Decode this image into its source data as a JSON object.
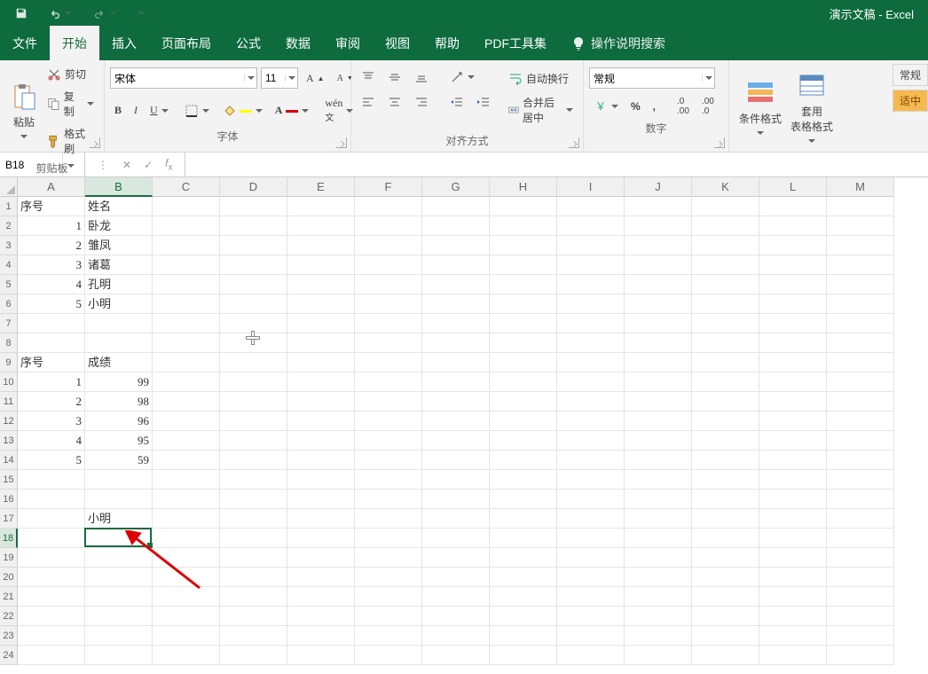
{
  "app": {
    "title": "演示文稿 - Excel"
  },
  "tabs": {
    "file": "文件",
    "home": "开始",
    "insert": "插入",
    "layout": "页面布局",
    "formulas": "公式",
    "data": "数据",
    "review": "审阅",
    "view": "视图",
    "help": "帮助",
    "pdf": "PDF工具集",
    "search": "操作说明搜索"
  },
  "ribbon": {
    "clipboard": {
      "paste": "粘贴",
      "cut": "剪切",
      "copy": "复制",
      "format_painter": "格式刷",
      "label": "剪贴板"
    },
    "font": {
      "name": "宋体",
      "size": "11",
      "label": "字体"
    },
    "alignment": {
      "wrap": "自动换行",
      "merge": "合并后居中",
      "label": "对齐方式"
    },
    "number": {
      "format": "常规",
      "label": "数字"
    },
    "styles": {
      "cond_format": "条件格式",
      "table_format": "套用\n表格格式"
    },
    "side": {
      "normal": "常规",
      "moderate": "适中"
    }
  },
  "formula_bar": {
    "name_box": "B18",
    "formula": ""
  },
  "columns": [
    "A",
    "B",
    "C",
    "D",
    "E",
    "F",
    "G",
    "H",
    "I",
    "J",
    "K",
    "L",
    "M"
  ],
  "row_count": 24,
  "selected": {
    "col": "B",
    "row": 18
  },
  "cells": {
    "A1": "序号",
    "B1": "姓名",
    "A2": "1",
    "B2": "卧龙",
    "A3": "2",
    "B3": "雏凤",
    "A4": "3",
    "B4": "诸葛",
    "A5": "4",
    "B5": "孔明",
    "A6": "5",
    "B6": "小明",
    "A9": "序号",
    "B9": "成绩",
    "A10": "1",
    "B10": "99",
    "A11": "2",
    "B11": "98",
    "A12": "3",
    "B12": "96",
    "A13": "4",
    "B13": "95",
    "A14": "5",
    "B14": "59",
    "B17": "小明"
  },
  "numeric_cells": [
    "A2",
    "A3",
    "A4",
    "A5",
    "A6",
    "A10",
    "A11",
    "A12",
    "A13",
    "A14",
    "B10",
    "B11",
    "B12",
    "B13",
    "B14"
  ]
}
